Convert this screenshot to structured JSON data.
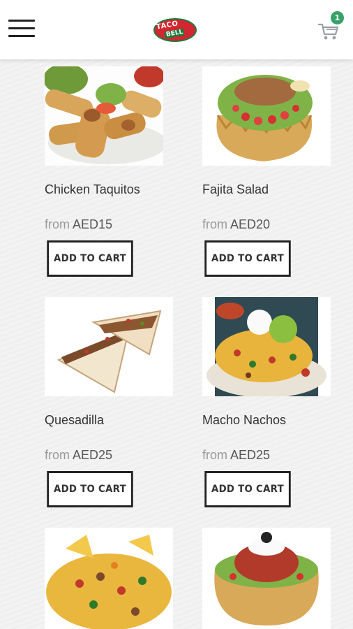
{
  "header": {
    "logo_line1": "TACO",
    "logo_line2": "BELL",
    "cart_count": "1"
  },
  "products": [
    {
      "name": "Chicken Taquitos",
      "price_prefix": "from",
      "price": "AED15",
      "button": "ADD TO CART"
    },
    {
      "name": "Fajita Salad",
      "price_prefix": "from",
      "price": "AED20",
      "button": "ADD TO CART"
    },
    {
      "name": "Quesadilla",
      "price_prefix": "from",
      "price": "AED25",
      "button": "ADD TO CART"
    },
    {
      "name": "Macho Nachos",
      "price_prefix": "from",
      "price": "AED25",
      "button": "ADD TO CART"
    },
    {
      "name": "",
      "price_prefix": "",
      "price": "",
      "button": ""
    },
    {
      "name": "",
      "price_prefix": "",
      "price": "",
      "button": ""
    }
  ],
  "colors": {
    "badge": "#38a169",
    "logo_red": "#d22630",
    "logo_green": "#1e7a3a",
    "button_border": "#222222"
  },
  "icons": [
    "hamburger-menu-icon",
    "cart-icon"
  ]
}
